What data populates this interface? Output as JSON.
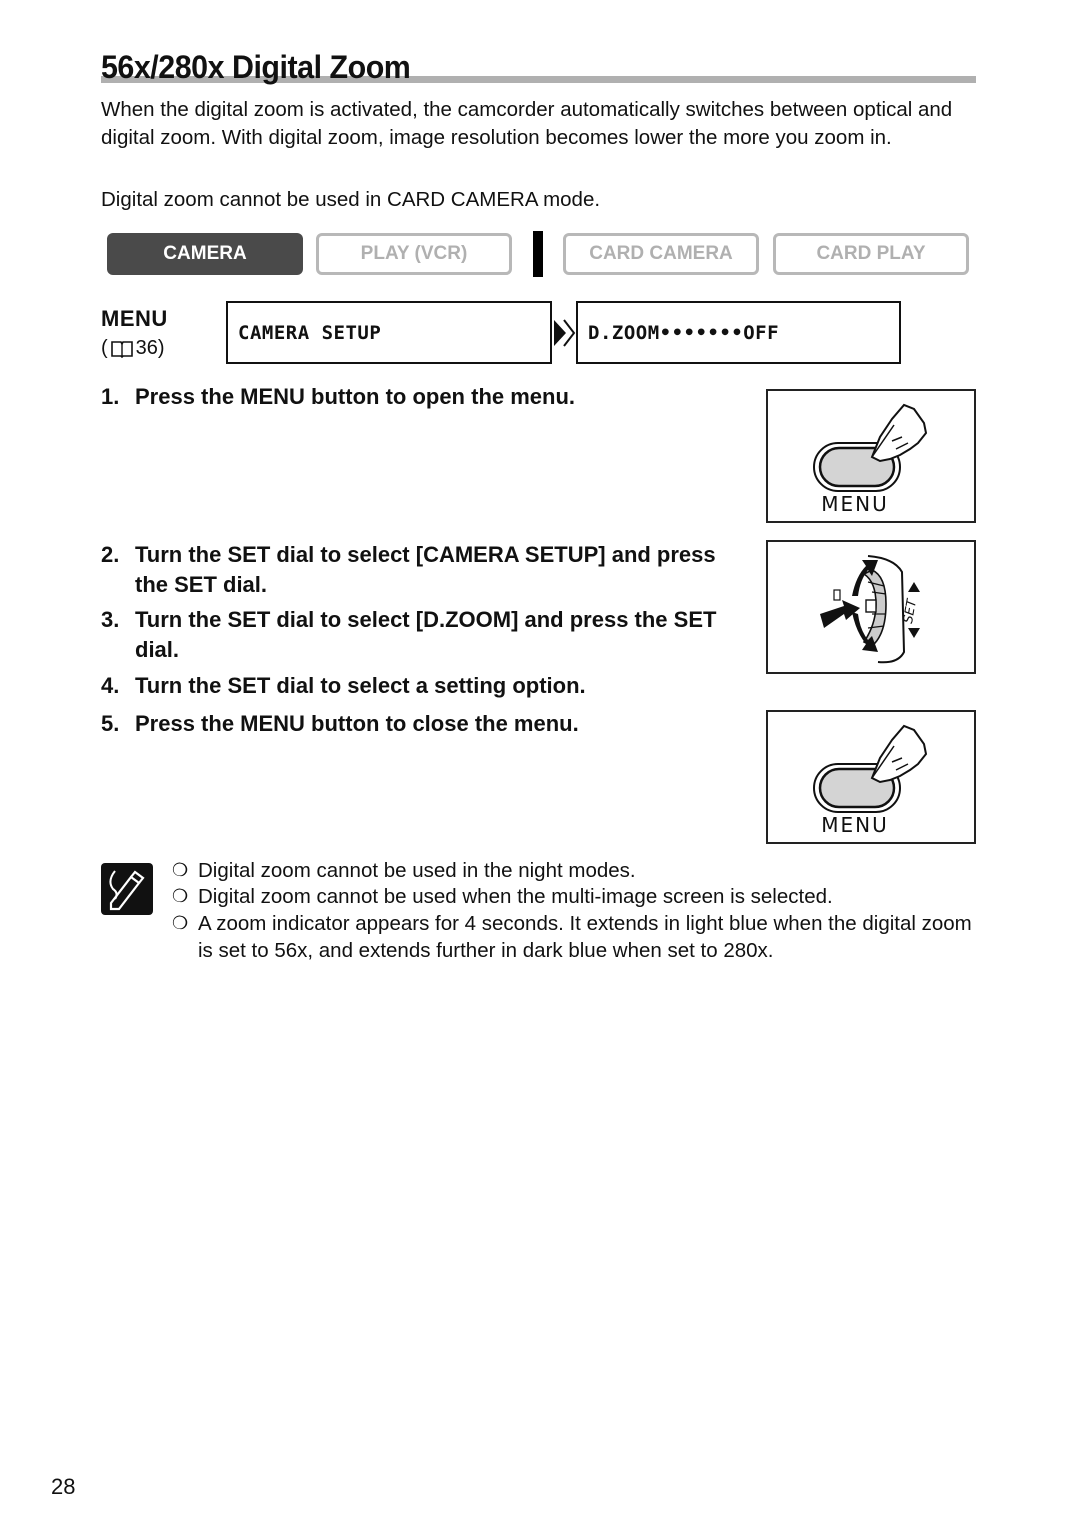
{
  "page": {
    "title": "56x/280x Digital Zoom",
    "intro": "When the digital zoom is activated, the camcorder automatically switches between optical and digital zoom. With digital zoom, image resolution becomes lower the more you zoom in.",
    "restriction": "Digital zoom cannot be used in CARD CAMERA mode.",
    "page_number": "28"
  },
  "modes": [
    {
      "label": "CAMERA",
      "active": true
    },
    {
      "label": "PLAY (VCR)",
      "active": false
    },
    {
      "label": "CARD CAMERA",
      "active": false
    },
    {
      "label": "CARD PLAY",
      "active": false
    }
  ],
  "menu": {
    "label": "MENU",
    "ref_open": "(",
    "ref_icon": "book-icon",
    "ref_page": "36)",
    "screen1": "CAMERA SETUP",
    "screen2": "D.ZOOM•••••••OFF"
  },
  "steps": [
    {
      "num": "1.",
      "text": "Press the MENU button to open the menu."
    },
    {
      "num": "2.",
      "text": "Turn the SET dial to select [CAMERA SETUP] and press the SET dial."
    },
    {
      "num": "3.",
      "text": "Turn the SET dial to select [D.ZOOM] and press the SET dial."
    },
    {
      "num": "4.",
      "text": "Turn the SET dial to select a setting option."
    },
    {
      "num": "5.",
      "text": "Press the MENU button to close the menu."
    }
  ],
  "illustrations": {
    "menu_button_label": "MENU",
    "set_dial_label": "SET"
  },
  "notes": {
    "bullet": "❍",
    "items": [
      "Digital zoom cannot be used in the night modes.",
      "Digital zoom cannot be used when the multi-image screen is selected.",
      "A zoom indicator appears for 4 seconds. It extends in light blue when the digital zoom is set to 56x, and extends further in dark blue when set to 280x."
    ]
  }
}
